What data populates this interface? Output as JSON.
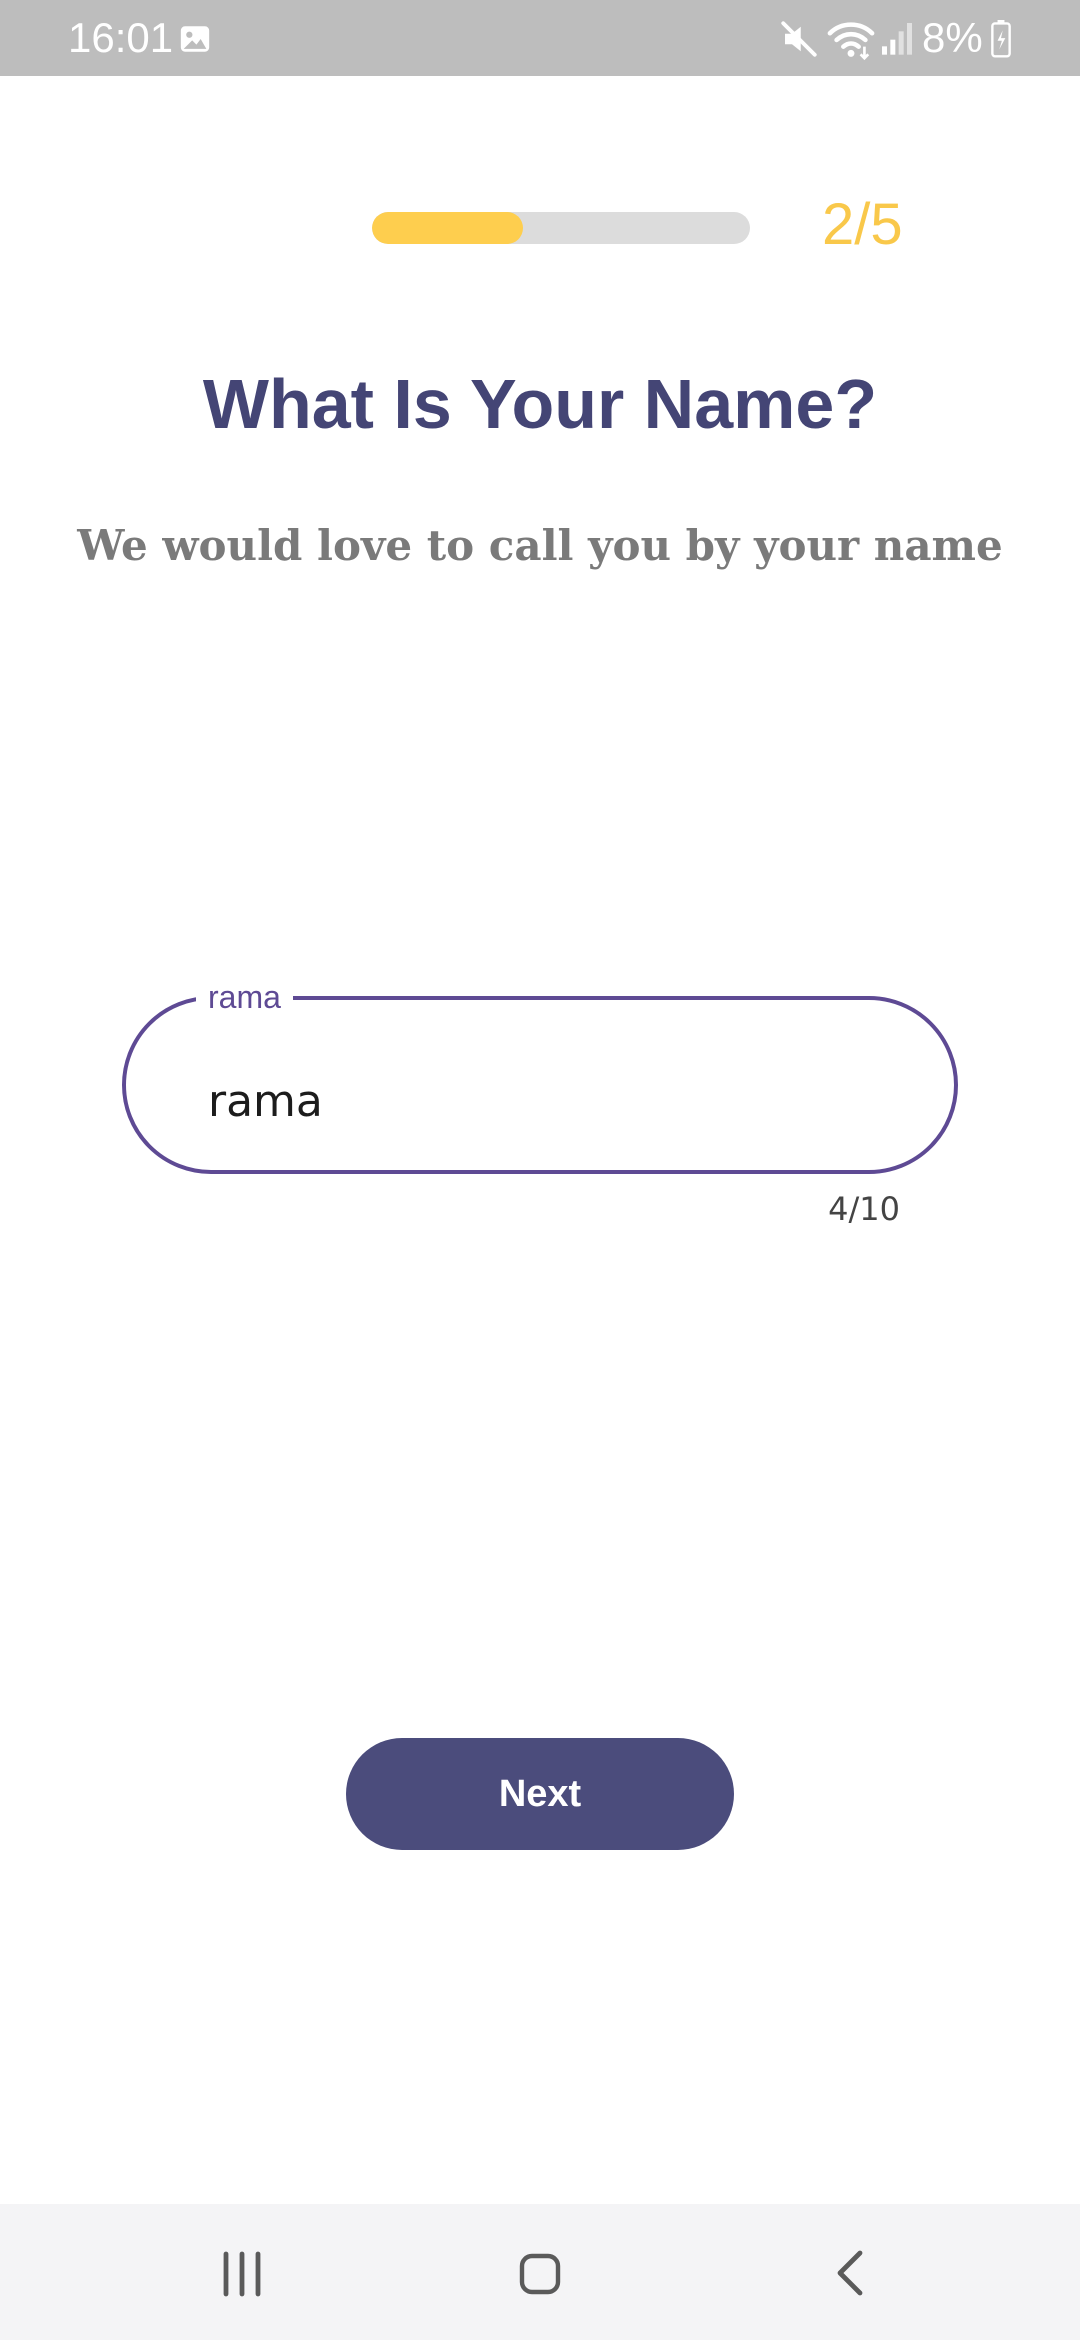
{
  "status_bar": {
    "time": "16:01",
    "battery": "8%",
    "icons": [
      "gallery-icon",
      "mute-icon",
      "wifi-icon",
      "signal-icon",
      "battery-icon"
    ]
  },
  "progress": {
    "step_text": "2/5",
    "fraction": 0.4,
    "fill_color": "#fece4e",
    "track_color": "#dcdcdc"
  },
  "header": {
    "title": "What Is Your Name?",
    "subtitle": "We would love to call you by your name"
  },
  "name_field": {
    "label": "rama",
    "value": "rama",
    "counter": "4/10"
  },
  "actions": {
    "next_label": "Next"
  },
  "nav_bar": {
    "icons": [
      "recents-icon",
      "home-icon",
      "back-icon"
    ]
  },
  "colors": {
    "accent": "#5e4a94",
    "title": "#444575",
    "button": "#4b4c7c",
    "step": "#f9c84a"
  }
}
